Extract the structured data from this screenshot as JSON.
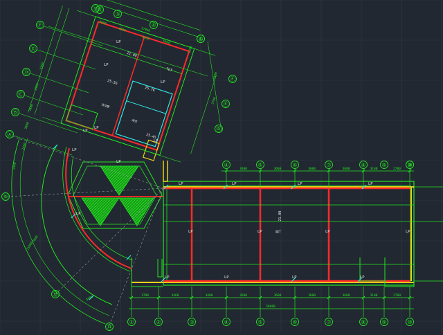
{
  "colors": {
    "background": "#222831",
    "grid": "#2e3540",
    "green": "#22e622",
    "red": "#ff2a2a",
    "yellow": "#e6d21a",
    "cyan": "#2fe6e6",
    "white": "#e6e6e6",
    "gray": "#9aa0a6"
  },
  "bottom_axes": {
    "bubbles": [
      "①",
      "②",
      "③",
      "④",
      "⑤",
      "⑥",
      "⑦",
      "⑧",
      "⑨",
      "⑩"
    ],
    "spans": [
      "1700",
      "3460",
      "3400",
      "3600",
      "3600",
      "3600",
      "3600",
      "3100",
      "2700"
    ],
    "total": "58000"
  },
  "top_axes": {
    "bubbles": [
      "④",
      "⑤",
      "⑥",
      "⑦",
      "⑧",
      "⑨",
      "⑩"
    ],
    "spans": [
      "3600",
      "3600",
      "3600",
      "3600",
      "3100",
      "2700"
    ]
  },
  "wing_top_axes": {
    "bubbles": [
      "⑪",
      "⑫",
      "③",
      "④",
      "⑤"
    ],
    "spans": [
      "2000",
      "4000",
      "3300",
      "5000"
    ],
    "total": "17800"
  },
  "wing_left_axes": {
    "bubbles": [
      "Ⓕ",
      "Ⓔ",
      "Ⓓ",
      "Ⓒ",
      "Ⓑ",
      "Ⓐ"
    ],
    "spans": [
      "3300",
      "3300",
      "3400",
      "3000",
      "2400"
    ]
  },
  "wing_right_axes": {
    "bubbles": [
      "⑥",
      "Ⓕ",
      "Ⓔ",
      "Ⓓ"
    ],
    "spans": [
      "1300",
      "2400",
      "3700"
    ]
  },
  "arc_axes": {
    "bubbles": [
      "Ⓑ",
      "⑫",
      "⑬"
    ],
    "dims": [
      "2860",
      "7000",
      "11000",
      "3600"
    ]
  },
  "room_labels": {
    "lp": "LP",
    "elev_wing": "21.00",
    "elev_main": "21.00",
    "elev_a": "25.56",
    "elev_b": "25.76",
    "elev_c": "25.45",
    "room_a": "活动室",
    "room_b": "阅览",
    "room_main": "展厅",
    "tag": "TLT"
  }
}
